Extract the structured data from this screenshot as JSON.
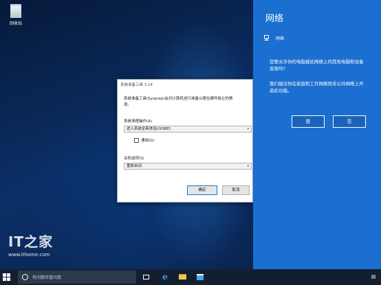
{
  "desktop": {
    "recycle_bin_label": "回收站",
    "watermark_logo": "IT之家",
    "watermark_site": "www.ithome.com"
  },
  "dialog": {
    "title": "系统准备工具 3.14",
    "description_lines": [
      "系统准备工具(Sysprep)会对计算机进行准备以便在硬件独立的情",
      "境。"
    ],
    "cleanup_label": "系统清理操作(A)",
    "cleanup_value": "进入系统全新体验(OOBE)",
    "generalize_label": "通用(G)",
    "generalize_checked": false,
    "shutdown_label": "关机选项(S)",
    "shutdown_value": "重新启动",
    "ok_label": "确定",
    "cancel_label": "取消"
  },
  "network_panel": {
    "title": "网络",
    "network_name": "网络",
    "question": "您要允许你的电脑被此网络上的其他电脑和设备发现吗?",
    "advice": "我们建议你在家庭和工作网络而非公共网络上开启此功能。",
    "yes_label": "是",
    "no_label": "否",
    "accent": "#1b6fd0"
  },
  "taskbar": {
    "search_placeholder": "有问题尽管问我",
    "icons": [
      "windows-logo-icon",
      "cortana-icon",
      "task-view-icon",
      "edge-icon",
      "file-explorer-icon",
      "store-icon",
      "network-tray-icon"
    ]
  }
}
